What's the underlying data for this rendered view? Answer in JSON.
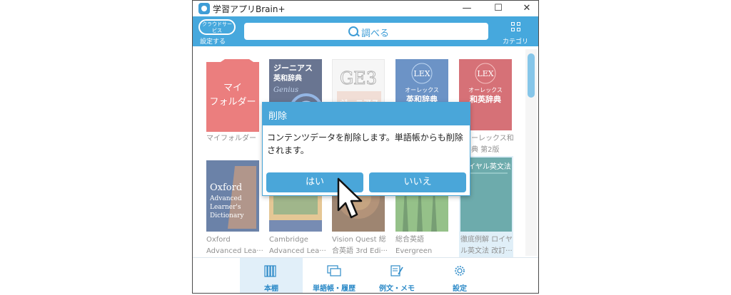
{
  "window": {
    "title": "学習アプリBrain+",
    "minimize": "—",
    "maximize": "☐",
    "close": "✕"
  },
  "header": {
    "cloud_badge": "クラウドサービス",
    "cloud_setting": "設定する",
    "search_label": "調べる",
    "category_label": "カテゴリ"
  },
  "books": [
    {
      "label1": "マイフォルダー",
      "label2": "",
      "cover_title": "マイ\nフォルダー",
      "color": "#e03a3a"
    },
    {
      "label1": "",
      "label2": "",
      "cover_title": "ジーニアス\n英和辞典",
      "color": "#1a2c56"
    },
    {
      "label1": "",
      "label2": "",
      "cover_title": "GE3",
      "color": "#f0f0f0"
    },
    {
      "label1": "",
      "label2": "",
      "cover_title": "LEX\nオーレックス\n英和辞典",
      "color": "#1e5aa8"
    },
    {
      "label1": "ーレックス和",
      "label2": "典 第2版",
      "cover_title": "LEX\nオーレックス\n和英辞典",
      "color": "#c0262e"
    },
    {
      "label1": "Oxford",
      "label2": "Advanced Lea···",
      "cover_title": "Oxford\nAdvanced\nLearner's\nDictionary",
      "color": "#1c3f7a"
    },
    {
      "label1": "Cambridge",
      "label2": "Advanced Lea···",
      "cover_title": "",
      "color": "#d8aa5c"
    },
    {
      "label1": "Vision Quest 総",
      "label2": "合英語 3rd Edi···",
      "cover_title": "",
      "color": "#6a4426"
    },
    {
      "label1": "総合英語",
      "label2": "Evergreen",
      "cover_title": "",
      "color": "#3e8a3e"
    },
    {
      "label1": "徹底例解 ロイヤ",
      "label2": "ル英文法 改訂···",
      "cover_title": "ロイヤル英文法",
      "color": "#1f7e80"
    }
  ],
  "dialog": {
    "title": "削除",
    "message": "コンテンツデータを削除します。単語帳からも削除されます。",
    "yes": "はい",
    "no": "いいえ"
  },
  "bottom_nav": [
    {
      "label": "本棚",
      "icon": "bookshelf-icon",
      "active": true
    },
    {
      "label": "単語帳・履歴",
      "icon": "wordbook-icon",
      "active": false
    },
    {
      "label": "例文・メモ",
      "icon": "memo-icon",
      "active": false
    },
    {
      "label": "設定",
      "icon": "gear-icon",
      "active": false
    }
  ],
  "colors": {
    "accent": "#46a8dd",
    "dialog": "#4aa6d9",
    "nav_text": "#2e8bc8"
  }
}
